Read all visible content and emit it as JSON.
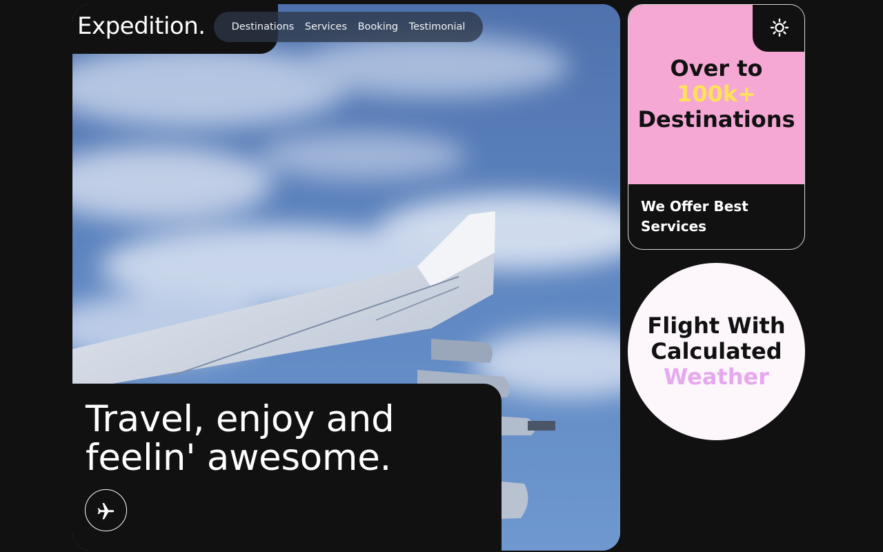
{
  "brand": {
    "logo": "Expedition."
  },
  "nav": {
    "items": [
      {
        "label": "Destinations"
      },
      {
        "label": "Services"
      },
      {
        "label": "Booking"
      },
      {
        "label": "Testimonial"
      }
    ]
  },
  "theme_toggle": {
    "icon": "sun-icon"
  },
  "hero": {
    "headline_line1": "Travel, enjoy and",
    "headline_line2": "feelin' awesome.",
    "cta_icon": "airplane-icon"
  },
  "destinations_card": {
    "title_line1": "Over to",
    "title_highlight": "100k+",
    "title_line3": "Destinations",
    "subtitle_line1": "We Offer Best",
    "subtitle_line2": "Services"
  },
  "weather_card": {
    "line1": "Flight With",
    "line2": "Calculated",
    "line3": "Weather"
  },
  "colors": {
    "background": "#111111",
    "pink": "#f5a8d4",
    "yellow": "#ffe259",
    "lavender": "#e6a8ef",
    "circle": "#fdf6fb"
  }
}
